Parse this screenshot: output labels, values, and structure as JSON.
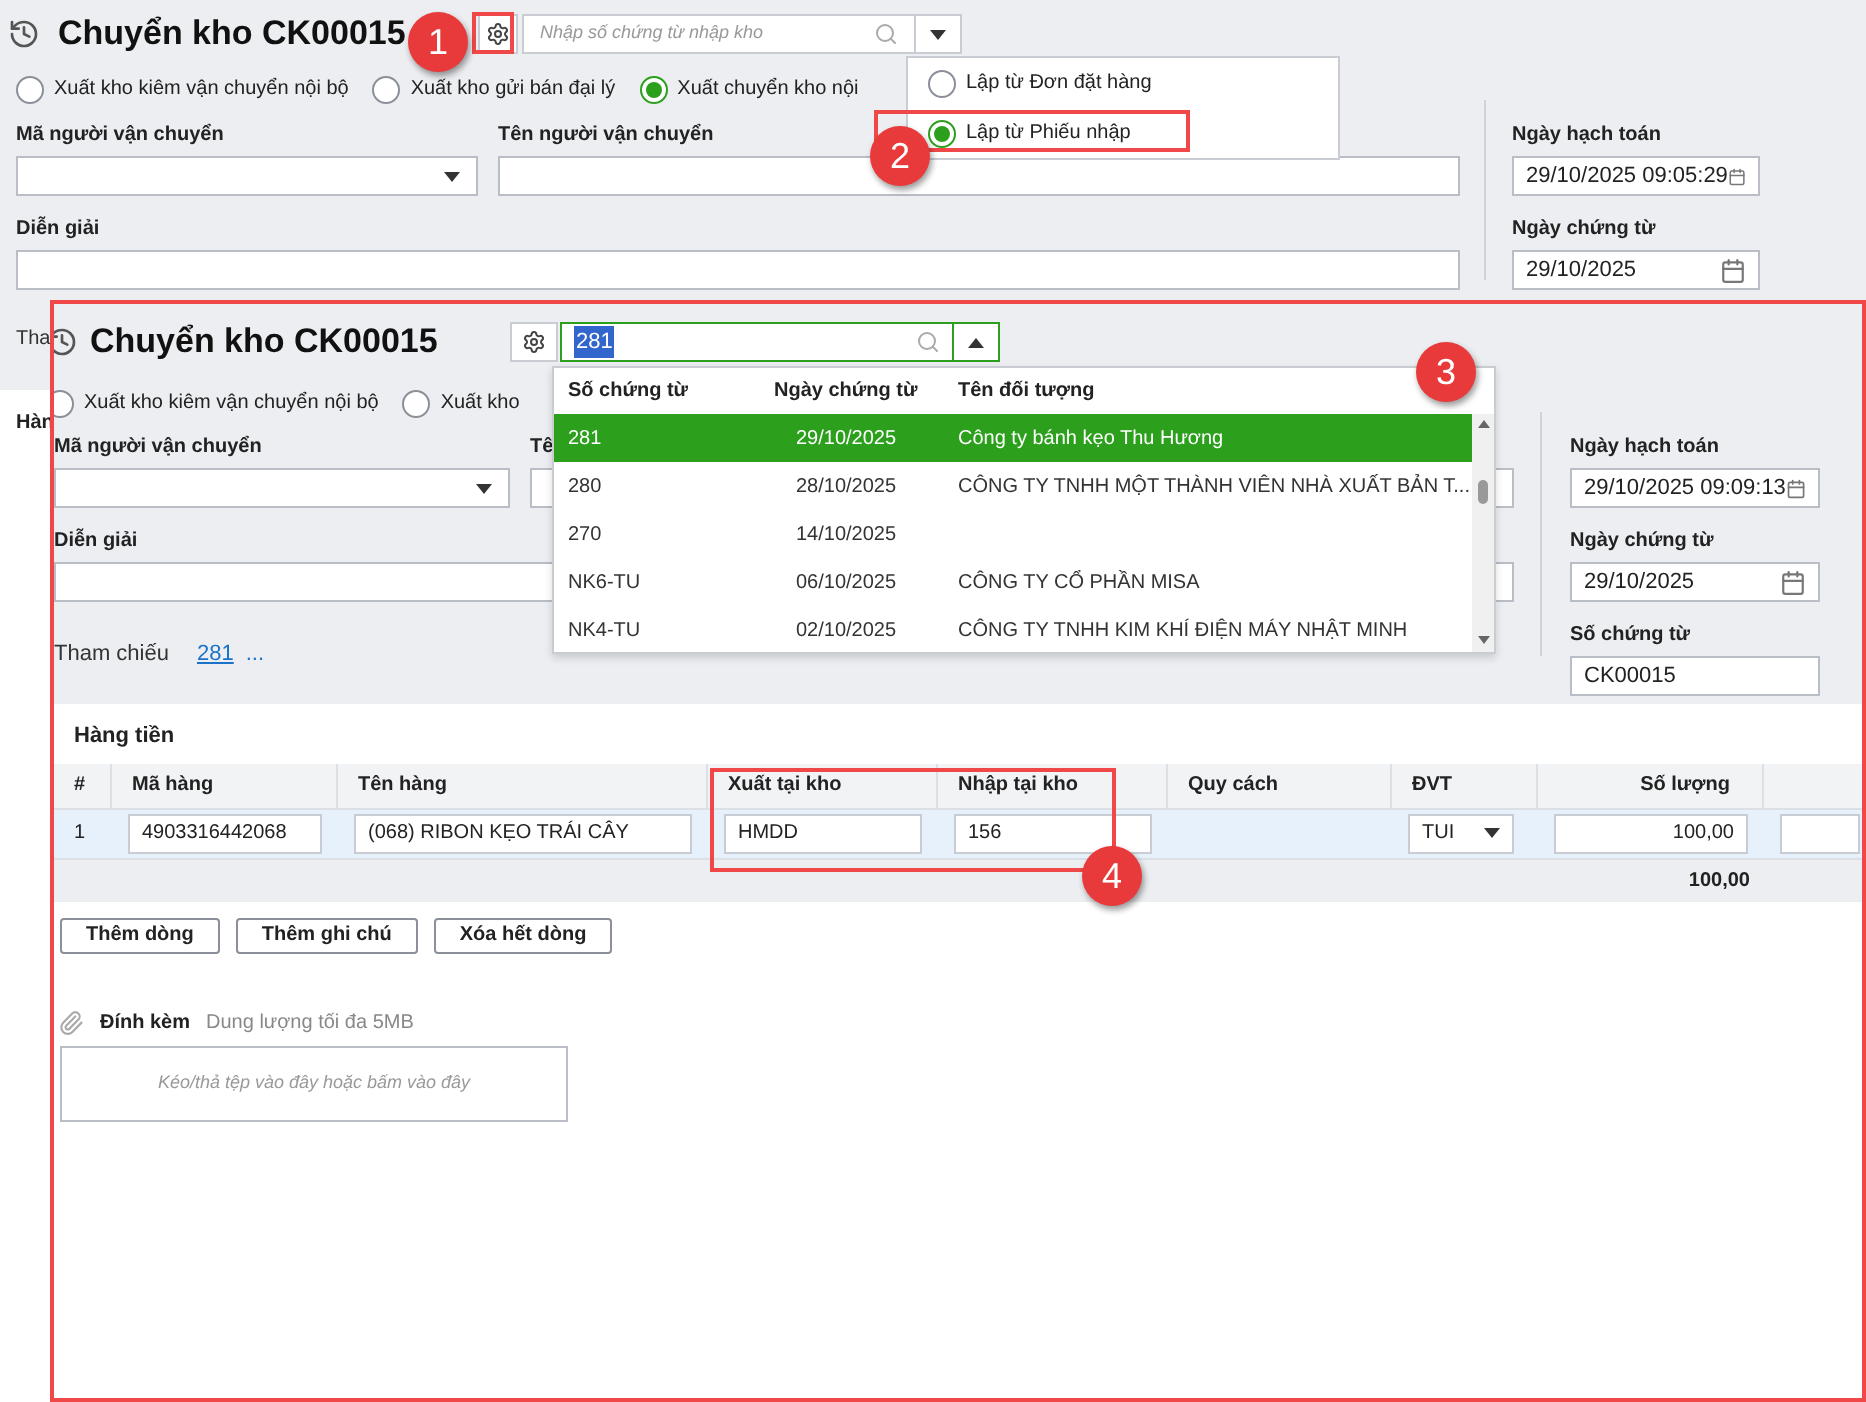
{
  "back_screen": {
    "title": "Chuyển kho CK00015",
    "voucher_search": {
      "placeholder": "Nhập số chứng từ nhập kho"
    },
    "create_menu": [
      {
        "label": "Lập từ Đơn đặt hàng",
        "selected": false
      },
      {
        "label": "Lập từ Phiếu nhập",
        "selected": true
      }
    ],
    "transfer_types": [
      {
        "label": "Xuất kho kiêm vận chuyển nội bộ",
        "selected": false
      },
      {
        "label": "Xuất kho gửi bán đại lý",
        "selected": false
      },
      {
        "label": "Xuất chuyển kho nội",
        "selected": true
      }
    ],
    "carrier_code_label": "Mã người vận chuyển",
    "carrier_name_label": "Tên người vận chuyển",
    "description_label": "Diễn giải",
    "posting_date": {
      "label": "Ngày hạch toán",
      "value": "29/10/2025 09:05:29"
    },
    "voucher_date": {
      "label": "Ngày chứng từ",
      "value": "29/10/2025"
    },
    "cut_labels": [
      "Tha",
      "Hàn"
    ]
  },
  "front_screen": {
    "title": "Chuyển kho CK00015",
    "voucher_search": {
      "value": "281"
    },
    "voucher_list": {
      "columns": [
        "Số chứng từ",
        "Ngày chứng từ",
        "Tên đối tượng"
      ],
      "rows": [
        {
          "cells": [
            "281",
            "29/10/2025",
            "Công ty bánh kẹo Thu Hương"
          ],
          "selected": true
        },
        {
          "cells": [
            "280",
            "28/10/2025",
            "CÔNG TY TNHH MỘT THÀNH VIÊN NHÀ XUẤT BẢN T..."
          ],
          "selected": false
        },
        {
          "cells": [
            "270",
            "14/10/2025",
            ""
          ],
          "selected": false
        },
        {
          "cells": [
            "NK6-TU",
            "06/10/2025",
            "CÔNG TY CỔ PHẦN MISA"
          ],
          "selected": false
        },
        {
          "cells": [
            "NK4-TU",
            "02/10/2025",
            "CÔNG TY TNHH KIM KHÍ ĐIỆN MÁY NHẬT MINH"
          ],
          "selected": false
        }
      ]
    },
    "transfer_types": [
      {
        "label": "Xuất kho kiêm vận chuyển nội bộ",
        "selected": false
      },
      {
        "label": "Xuất kho",
        "selected": false
      }
    ],
    "carrier_code_label": "Mã người vận chuyển",
    "carrier_name_label": "Tê",
    "description_label": "Diễn giải",
    "reference": {
      "label": "Tham chiếu",
      "link": "281",
      "more": "..."
    },
    "posting_date": {
      "label": "Ngày hạch toán",
      "value": "29/10/2025 09:09:13"
    },
    "voucher_date": {
      "label": "Ngày chứng từ",
      "value": "29/10/2025"
    },
    "voucher_number": {
      "label": "Số chứng từ",
      "value": "CK00015"
    },
    "items_section": "Hàng tiền",
    "items_table": {
      "columns": [
        "#",
        "Mã hàng",
        "Tên hàng",
        "Xuất tại kho",
        "Nhập tại kho",
        "Quy cách",
        "ĐVT",
        "Số lượng"
      ],
      "rows": [
        {
          "cells": [
            "1",
            "4903316442068",
            "(068) RIBON KẸO TRÁI CÂY",
            "HMDD",
            "156",
            "",
            "TUI",
            "100,00"
          ]
        }
      ],
      "total": "100,00"
    },
    "buttons": [
      "Thêm dòng",
      "Thêm ghi chú",
      "Xóa hết dòng"
    ],
    "attachment": {
      "label": "Đính kèm",
      "hint": "Dung lượng tối đa 5MB",
      "drop_text": "Kéo/thả tệp vào đây hoặc bấm vào đây"
    }
  },
  "callouts": [
    "1",
    "2",
    "3",
    "4"
  ]
}
